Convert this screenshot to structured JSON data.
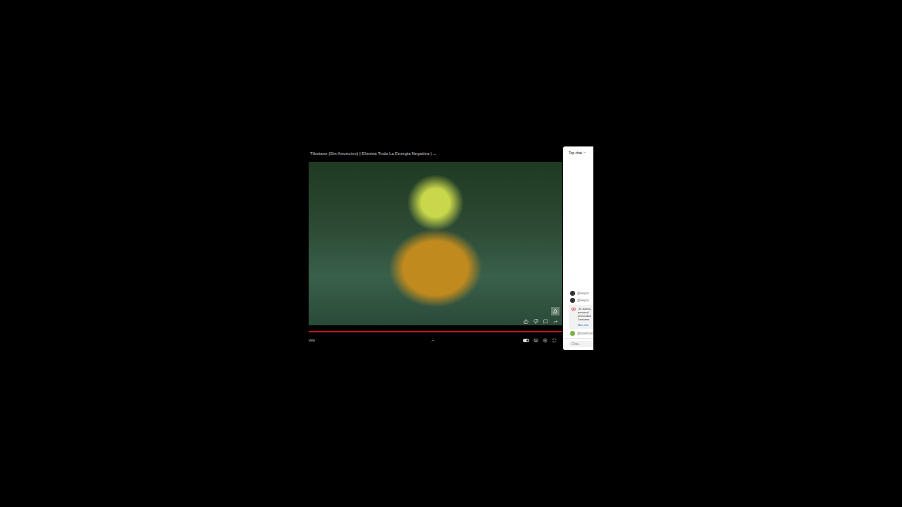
{
  "player": {
    "title": "Tibetane (Sin Anuncios) | Elimina Toda La Energía Negativa | ...",
    "progress": {
      "level": 1.0
    },
    "live_label": "vivo",
    "autoplay": {
      "on": true
    }
  },
  "chat": {
    "header": "Top chat",
    "messages": [
      {
        "author": "@eeyou",
        "avatar_color": "#333333"
      },
      {
        "author": "@eeyou",
        "avatar_color": "#333333"
      }
    ],
    "notice": {
      "lines": [
        "¡Te damos",
        "personal",
        "privacidad",
        "Lineamie"
      ],
      "link": "Más info"
    },
    "last_message": {
      "author": "@lovemusi",
      "avatar_color": "#7cb342"
    },
    "input": {
      "placeholder": "Chat..."
    }
  }
}
